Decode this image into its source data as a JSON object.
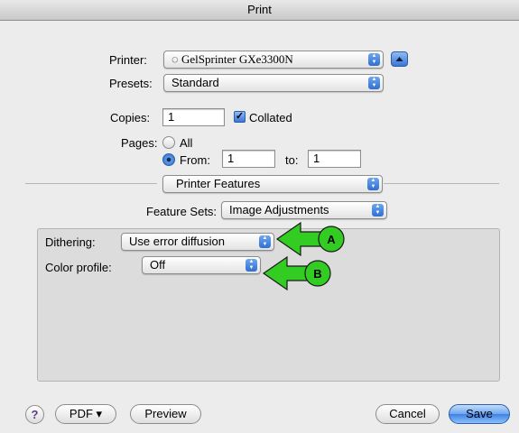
{
  "window": {
    "title": "Print"
  },
  "printer": {
    "label": "Printer:",
    "value": "GelSprinter GXe3300N"
  },
  "presets": {
    "label": "Presets:",
    "value": "Standard"
  },
  "copies": {
    "label": "Copies:",
    "value": "1",
    "collated_label": "Collated",
    "collated_checked": true
  },
  "pages": {
    "label": "Pages:",
    "all_label": "All",
    "from_label": "From:",
    "from_value": "1",
    "to_label": "to:",
    "to_value": "1",
    "selected": "from"
  },
  "section": {
    "value": "Printer Features"
  },
  "feature_sets": {
    "label": "Feature Sets:",
    "value": "Image Adjustments"
  },
  "dithering": {
    "label": "Dithering:",
    "value": "Use error diffusion"
  },
  "color_profile": {
    "label": "Color profile:",
    "value": "Off"
  },
  "callouts": {
    "a": "A",
    "b": "B",
    "color": "#33cc22"
  },
  "footer": {
    "help": "?",
    "pdf": "PDF ▾",
    "preview": "Preview",
    "cancel": "Cancel",
    "save": "Save"
  },
  "colors": {
    "accent": "#3f82e6"
  }
}
